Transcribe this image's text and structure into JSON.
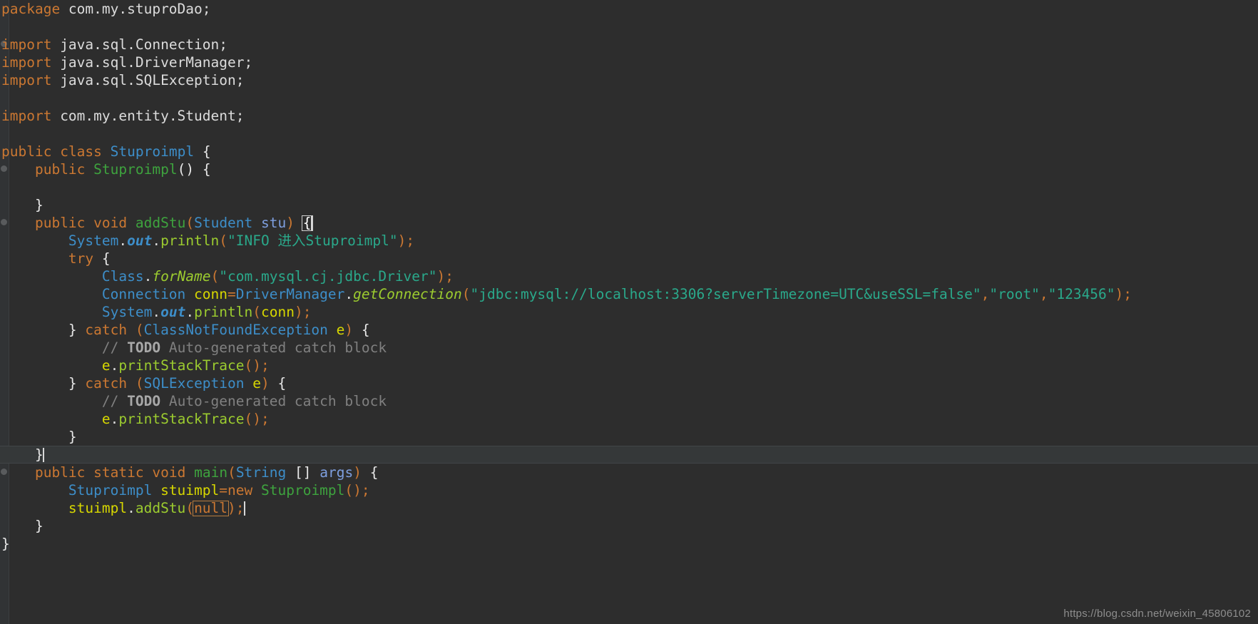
{
  "editor": {
    "theme": "dark",
    "background": "#2d2d2d",
    "current_line_background": "#353839",
    "language": "Java",
    "colors": {
      "keyword": "#cc7832",
      "type": "#3d8ec9",
      "method_declaration": "#3ea33e",
      "method_call": "#9ccc2f",
      "string": "#2aa98b",
      "parameter": "#7e9fe0",
      "local_variable": "#d7d700",
      "comment": "#808080",
      "foreground": "#dcdcdc"
    }
  },
  "code": {
    "line01": {
      "kw": "package",
      "rest": " com.my.stuproDao;"
    },
    "line02": {
      "text": ""
    },
    "line03": {
      "kw": "import",
      "rest": " java.sql.Connection;"
    },
    "line04": {
      "kw": "import",
      "rest": " java.sql.DriverManager;"
    },
    "line05": {
      "kw": "import",
      "rest": " java.sql.SQLException;"
    },
    "line06": {
      "text": ""
    },
    "line07": {
      "kw": "import",
      "rest": " com.my.entity.Student;"
    },
    "line08": {
      "text": ""
    },
    "line09": {
      "kw1": "public",
      "kw2": "class",
      "type": "Stuproimpl",
      "brace": "{"
    },
    "line10": {
      "indent": "    ",
      "kw": "public",
      "meth": "Stuproimpl",
      "parens": "()",
      "brace": "{"
    },
    "line11": {
      "text": ""
    },
    "line12": {
      "indent": "    ",
      "brace": "}"
    },
    "line13": {
      "indent": "    ",
      "kw1": "public",
      "kw2": "void",
      "meth": "addStu",
      "lparen": "(",
      "type": "Student",
      "param": "stu",
      "rparen": ")",
      "brace": "{"
    },
    "line14": {
      "indent": "        ",
      "type": "System",
      "dot1": ".",
      "field": "out",
      "dot2": ".",
      "call": "println",
      "lparen": "(",
      "string": "\"INFO 进入Stuproimpl\"",
      "tail": ");"
    },
    "line15": {
      "indent": "        ",
      "kw": "try",
      "brace": "{"
    },
    "line16": {
      "indent": "            ",
      "type": "Class",
      "dot": ".",
      "call": "forName",
      "lparen": "(",
      "string": "\"com.mysql.cj.jdbc.Driver\"",
      "tail": ");"
    },
    "line17": {
      "indent": "            ",
      "type": "Connection",
      "local": "conn",
      "eq": "=",
      "type2": "DriverManager",
      "dot": ".",
      "call": "getConnection",
      "lparen": "(",
      "string1": "\"jdbc:mysql://localhost:3306?serverTimezone=UTC&useSSL=false\"",
      "comma1": ",",
      "string2": "\"root\"",
      "comma2": ",",
      "string3": "\"123456\"",
      "tail": ");"
    },
    "line18": {
      "indent": "            ",
      "type": "System",
      "dot1": ".",
      "field": "out",
      "dot2": ".",
      "call": "println",
      "lparen": "(",
      "arg": "conn",
      "tail": ");"
    },
    "line19": {
      "indent": "        ",
      "rbrace": "}",
      "kw": "catch",
      "lparen": "(",
      "type": "ClassNotFoundException",
      "local": "e",
      "rparen": ")",
      "brace": "{"
    },
    "line20": {
      "indent": "            ",
      "slashes": "// ",
      "todo": "TODO",
      "comment": " Auto-generated catch block"
    },
    "line21": {
      "indent": "            ",
      "local": "e",
      "dot": ".",
      "call": "printStackTrace",
      "tail": "();"
    },
    "line22": {
      "indent": "        ",
      "rbrace": "}",
      "kw": "catch",
      "lparen": "(",
      "type": "SQLException",
      "local": "e",
      "rparen": ")",
      "brace": "{"
    },
    "line23": {
      "indent": "            ",
      "slashes": "// ",
      "todo": "TODO",
      "comment": " Auto-generated catch block"
    },
    "line24": {
      "indent": "            ",
      "local": "e",
      "dot": ".",
      "call": "printStackTrace",
      "tail": "();"
    },
    "line25": {
      "indent": "        ",
      "brace": "}"
    },
    "line26": {
      "indent": "    ",
      "brace": "}"
    },
    "line27": {
      "indent": "    ",
      "kw1": "public",
      "kw2": "static",
      "kw3": "void",
      "meth": "main",
      "lparen": "(",
      "type": "String",
      "brackets": "[]",
      "param": "args",
      "rparen": ")",
      "brace": "{"
    },
    "line28": {
      "indent": "        ",
      "type": "Stuproimpl",
      "local": "stuimpl",
      "eq": "=",
      "kw": "new",
      "ctor": "Stuproimpl",
      "tail": "();"
    },
    "line29": {
      "indent": "        ",
      "local": "stuimpl",
      "dot": ".",
      "call": "addStu",
      "lparen": "(",
      "nullkw": "null",
      "tail": ");"
    },
    "line30": {
      "indent": "    ",
      "brace": "}"
    },
    "line31": {
      "brace": "}"
    }
  },
  "watermark": {
    "url": "https://blog.csdn.net/weixin_45806102"
  }
}
